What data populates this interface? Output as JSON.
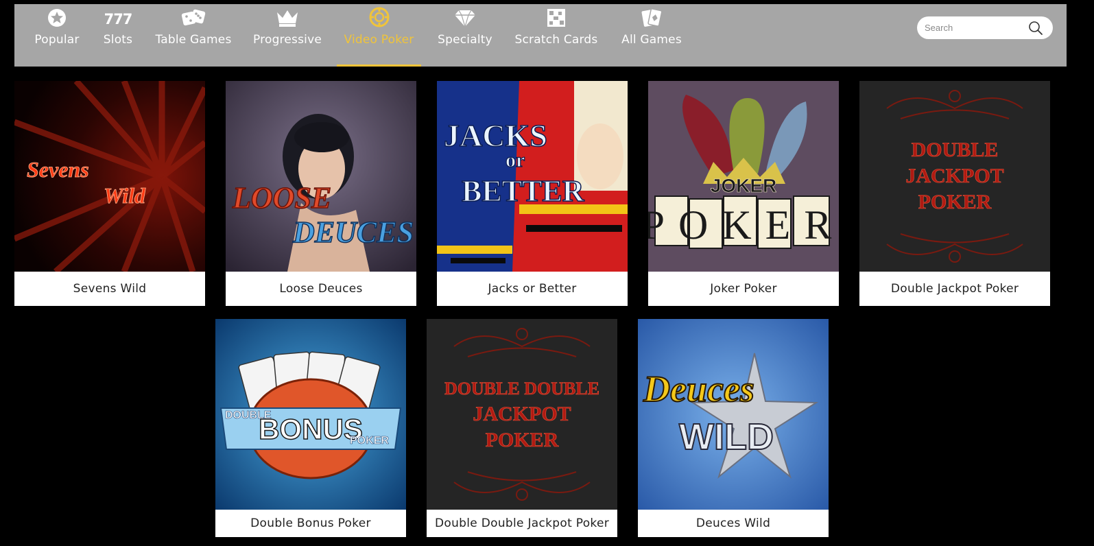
{
  "nav": {
    "tabs": [
      {
        "label": "Popular",
        "icon": "star-icon",
        "active": false
      },
      {
        "label": "Slots",
        "icon": "triple-seven-icon",
        "icon_text": "777",
        "active": false
      },
      {
        "label": "Table Games",
        "icon": "dice-icon",
        "active": false
      },
      {
        "label": "Progressive",
        "icon": "crown-icon",
        "active": false
      },
      {
        "label": "Video Poker",
        "icon": "poker-chip-icon",
        "active": true
      },
      {
        "label": "Specialty",
        "icon": "diamond-icon",
        "active": false
      },
      {
        "label": "Scratch Cards",
        "icon": "scratch-card-icon",
        "active": false
      },
      {
        "label": "All Games",
        "icon": "cards-icon",
        "active": false
      }
    ],
    "search": {
      "placeholder": "Search",
      "value": ""
    }
  },
  "colors": {
    "nav_bg": "#a6a6a6",
    "active": "#f0c43a",
    "page_bg": "#000000",
    "caption_bg": "#ffffff"
  },
  "games": [
    {
      "title": "Sevens Wild",
      "art": {
        "line1": "Sevens",
        "line2": "Wild"
      }
    },
    {
      "title": "Loose Deuces",
      "art": {
        "line1": "LOOSE",
        "line2": "DEUCES"
      }
    },
    {
      "title": "Jacks or Better",
      "art": {
        "line1": "JACKS",
        "line2": "or",
        "line3": "BETTER"
      }
    },
    {
      "title": "Joker Poker",
      "art": {
        "line1": "JOKER",
        "line2": "POKER"
      }
    },
    {
      "title": "Double Jackpot Poker",
      "art": {
        "line1": "DOUBLE",
        "line2": "JACKPOT",
        "line3": "POKER"
      }
    },
    {
      "title": "Double Bonus Poker",
      "art": {
        "line1": "DOUBLE",
        "line2": "BONUS",
        "line3": "POKER"
      }
    },
    {
      "title": "Double Double Jackpot Poker",
      "art": {
        "line1": "DOUBLE DOUBLE",
        "line2": "JACKPOT",
        "line3": "POKER"
      }
    },
    {
      "title": "Deuces Wild",
      "art": {
        "line1": "Deuces",
        "line2": "WILD"
      }
    }
  ]
}
